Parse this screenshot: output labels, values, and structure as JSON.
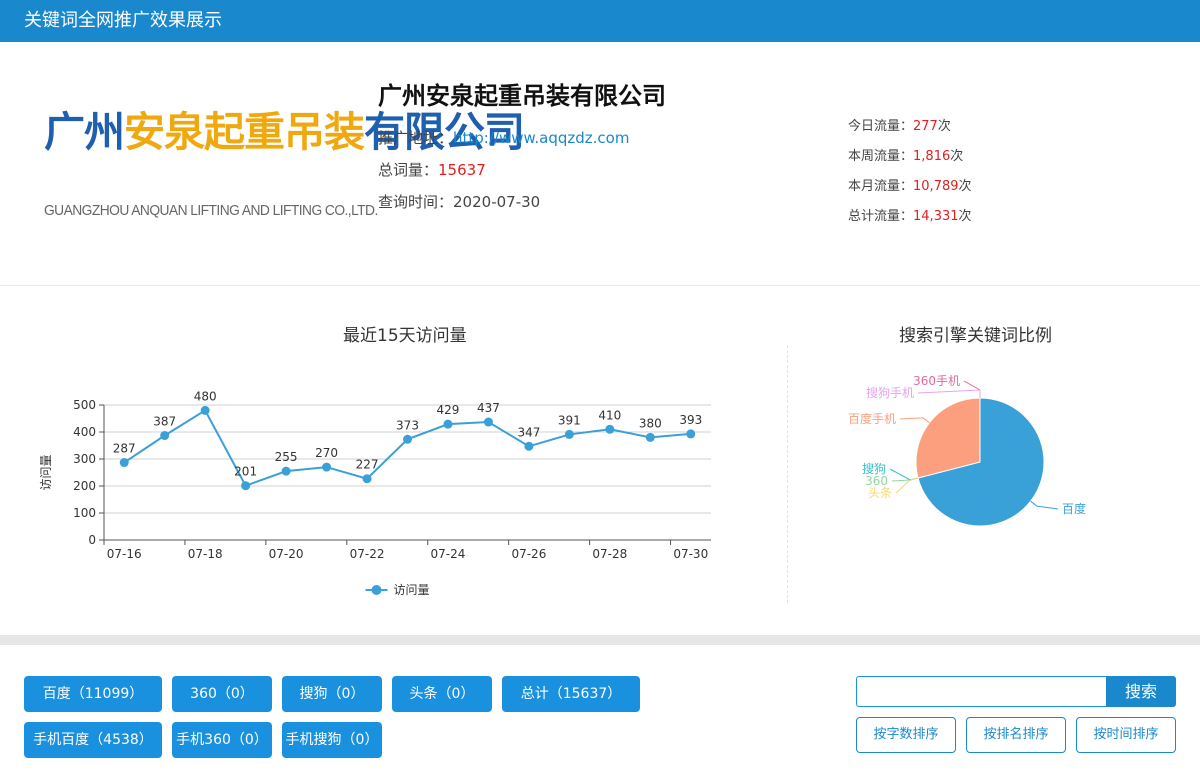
{
  "topbar": {
    "title": "关键词全网推广效果展示"
  },
  "logo": {
    "cn_part1": "广州",
    "cn_part2": "安泉起重吊装",
    "cn_part3": "有限公司",
    "en": "GUANGZHOU ANQUAN LIFTING AND LIFTING CO.,LTD."
  },
  "company": {
    "name": "广州安泉起重吊装有限公司",
    "url_label": "推广地址：",
    "url": "http://www.aqqzdz.com",
    "total_words_label": "总词量：",
    "total_words": "15637",
    "query_time_label": "查询时间：",
    "query_time": "2020-07-30"
  },
  "stats": [
    {
      "label": "今日流量：",
      "value": "277",
      "unit": "次"
    },
    {
      "label": "本周流量：",
      "value": "1,816",
      "unit": "次"
    },
    {
      "label": "本月流量：",
      "value": "10,789",
      "unit": "次"
    },
    {
      "label": "总计流量：",
      "value": "14,331",
      "unit": "次"
    }
  ],
  "chart_data": [
    {
      "type": "line",
      "title": "最近15天访问量",
      "ylabel": "访问量",
      "ylim": [
        0,
        500
      ],
      "yticks": [
        0,
        100,
        200,
        300,
        400,
        500
      ],
      "x": [
        "07-16",
        "07-17",
        "07-18",
        "07-19",
        "07-20",
        "07-21",
        "07-22",
        "07-23",
        "07-24",
        "07-25",
        "07-26",
        "07-27",
        "07-28",
        "07-29",
        "07-30"
      ],
      "x_tick_labels": [
        "07-16",
        "07-18",
        "07-20",
        "07-22",
        "07-24",
        "07-26",
        "07-28",
        "07-30"
      ],
      "series": [
        {
          "name": "访问量",
          "values": [
            287,
            387,
            480,
            201,
            255,
            270,
            227,
            373,
            429,
            437,
            347,
            391,
            410,
            380,
            393
          ],
          "color": "#3aa0d8"
        }
      ],
      "legend": "bottom",
      "grid": true
    },
    {
      "type": "pie",
      "title": "搜索引擎关键词比例",
      "slices": [
        {
          "label": "百度",
          "value": 11099,
          "color": "#3aa0d8"
        },
        {
          "label": "360",
          "value": 0,
          "color": "#8fd8a0"
        },
        {
          "label": "搜狗",
          "value": 0,
          "color": "#37c1d0"
        },
        {
          "label": "头条",
          "value": 0,
          "color": "#f7d774"
        },
        {
          "label": "百度手机",
          "value": 4538,
          "color": "#fb9f7f"
        },
        {
          "label": "360手机",
          "value": 0,
          "color": "#e06a9e"
        },
        {
          "label": "搜狗手机",
          "value": 0,
          "color": "#e7a3f0"
        }
      ]
    }
  ],
  "filters": {
    "row1": [
      {
        "label": "百度（11099）"
      },
      {
        "label": "360（0）"
      },
      {
        "label": "搜狗（0）"
      },
      {
        "label": "头条（0）"
      },
      {
        "label": "总计（15637）"
      }
    ],
    "row2": [
      {
        "label": "手机百度（4538）"
      },
      {
        "label": "手机360（0）"
      },
      {
        "label": "手机搜狗（0）"
      }
    ]
  },
  "search": {
    "placeholder": "",
    "button": "搜索"
  },
  "sort": {
    "by_chars": "按字数排序",
    "by_rank": "按排名排序",
    "by_time": "按时间排序"
  }
}
